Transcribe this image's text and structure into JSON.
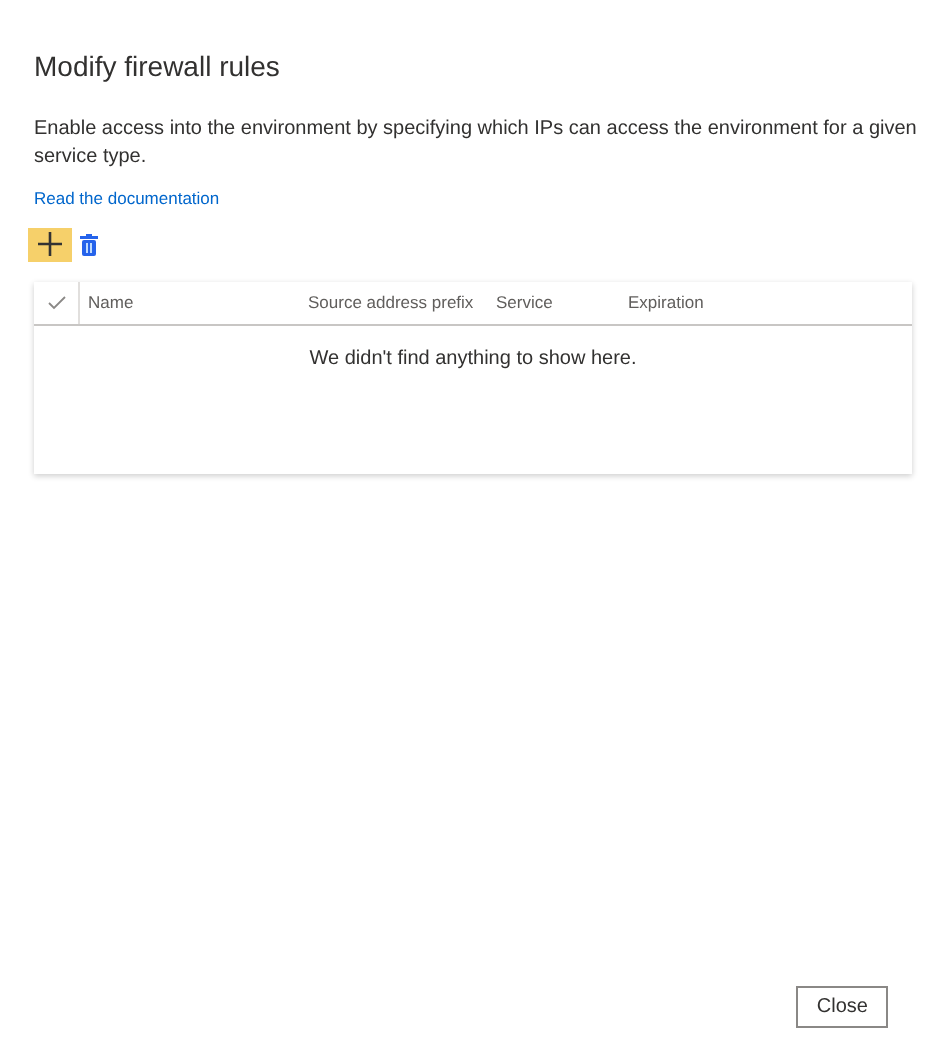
{
  "dialog": {
    "title": "Modify firewall rules",
    "description": "Enable access into the environment by specifying which IPs can access the environment for a given service type.",
    "link": "Read the documentation"
  },
  "toolbar": [
    {
      "kind": "add",
      "highlighted": true
    },
    {
      "kind": "delete",
      "highlighted": false
    }
  ],
  "table": {
    "columns": [
      "Name",
      "Source address prefix",
      "Service",
      "Expiration"
    ],
    "empty_message": "We didn't find anything to show here."
  },
  "buttons": [
    "Close"
  ]
}
